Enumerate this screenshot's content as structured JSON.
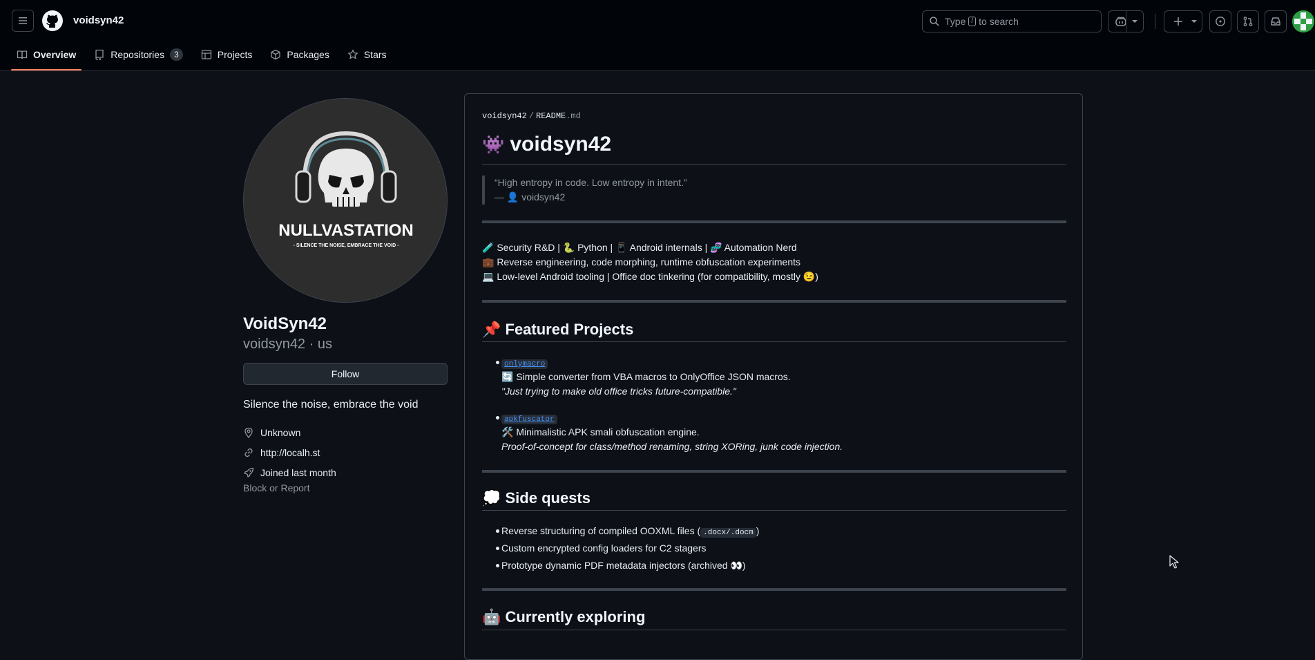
{
  "header": {
    "username": "voidsyn42",
    "search_prefix": "Type",
    "search_key": "/",
    "search_suffix": "to search"
  },
  "tabs": [
    {
      "label": "Overview",
      "icon": "book-icon"
    },
    {
      "label": "Repositories",
      "icon": "repo-icon",
      "count": "3"
    },
    {
      "label": "Projects",
      "icon": "table-icon"
    },
    {
      "label": "Packages",
      "icon": "package-icon"
    },
    {
      "label": "Stars",
      "icon": "star-icon"
    }
  ],
  "profile": {
    "avatar_text": "NULLVASTATION",
    "avatar_tagline": "- SILENCE THE NOISE, EMBRACE THE VOID -",
    "full_name": "VoidSyn42",
    "nickname": "voidsyn42 · us",
    "follow_label": "Follow",
    "bio": "Silence the noise, embrace the void",
    "location": "Unknown",
    "website": "http://localh.st",
    "joined": "Joined last month",
    "block_label": "Block or Report"
  },
  "readme": {
    "crumb_owner": "voidsyn42",
    "crumb_sep": "/",
    "crumb_file": "README",
    "crumb_ext": ".md",
    "title_emoji": "👾",
    "title": "voidsyn42",
    "quote_line1": "“High entropy in code. Low entropy in intent.”",
    "quote_line2": "— 👤 voidsyn42",
    "intro": [
      "🧪 Security R&D | 🐍 Python | 📱 Android internals | 🧬 Automation Nerd",
      "💼 Reverse engineering, code morphing, runtime obfuscation experiments",
      "💻 Low-level Android tooling | Office doc tinkering (for compatibility, mostly 😉)"
    ],
    "featured_heading": "📌 Featured Projects",
    "projects": [
      {
        "name": "onlymacro",
        "desc": "🔄 Simple converter from VBA macros to OnlyOffice JSON macros.",
        "note": "\"Just trying to make old office tricks future-compatible.\""
      },
      {
        "name": "apkfuscator",
        "desc": "🛠️ Minimalistic APK smali obfuscation engine.",
        "note": "Proof-of-concept for class/method renaming, string XORing, junk code injection."
      }
    ],
    "side_heading": "💭 Side quests",
    "side_items": [
      {
        "prefix": "Reverse structuring of compiled OOXML files (",
        "code": ".docx/.docm",
        "suffix": ")"
      },
      {
        "prefix": "Custom encrypted config loaders for C2 stagers",
        "code": "",
        "suffix": ""
      },
      {
        "prefix": "Prototype dynamic PDF metadata injectors (archived 👀)",
        "code": "",
        "suffix": ""
      }
    ],
    "exploring_heading": "🤖 Currently exploring"
  },
  "colors": {
    "bg": "#0d1117",
    "header_bg": "#010409",
    "accent_tab": "#f78166",
    "link": "#4493f8"
  }
}
